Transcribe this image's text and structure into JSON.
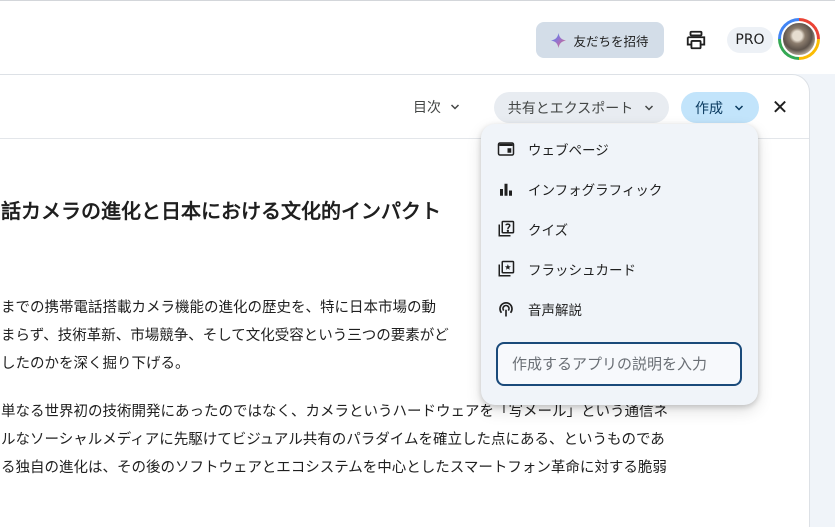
{
  "header": {
    "invite_label": "友だちを招待",
    "pro_label": "PRO"
  },
  "toolbar": {
    "toc_label": "目次",
    "share_label": "共有とエクスポート",
    "create_label": "作成",
    "close_label": "✕"
  },
  "document": {
    "title": "話カメラの進化と日本における文化的インパクト",
    "paragraph1": [
      "までの携帯電話搭載カメラ機能の進化の歴史を、特に日本市場の動",
      "まらず、技術革新、市場競争、そして文化受容という三つの要素がど",
      "したのかを深く掘り下げる。"
    ],
    "paragraph2": [
      "単なる世界初の技術開発にあったのではなく、カメラというハードウェアを「写メール」という通信ネ",
      "ルなソーシャルメディアに先駆けてビジュアル共有のパラダイムを確立した点にある、というものであ",
      "る独自の進化は、その後のソフトウェアとエコシステムを中心としたスマートフォン革命に対する脆弱"
    ]
  },
  "create_menu": {
    "items": [
      {
        "label": "ウェブページ",
        "icon": "webpage-icon"
      },
      {
        "label": "インフォグラフィック",
        "icon": "bar-chart-icon"
      },
      {
        "label": "クイズ",
        "icon": "quiz-icon"
      },
      {
        "label": "フラッシュカード",
        "icon": "flashcard-icon"
      },
      {
        "label": "音声解説",
        "icon": "podcast-icon"
      }
    ],
    "input_placeholder": "作成するアプリの説明を入力"
  }
}
